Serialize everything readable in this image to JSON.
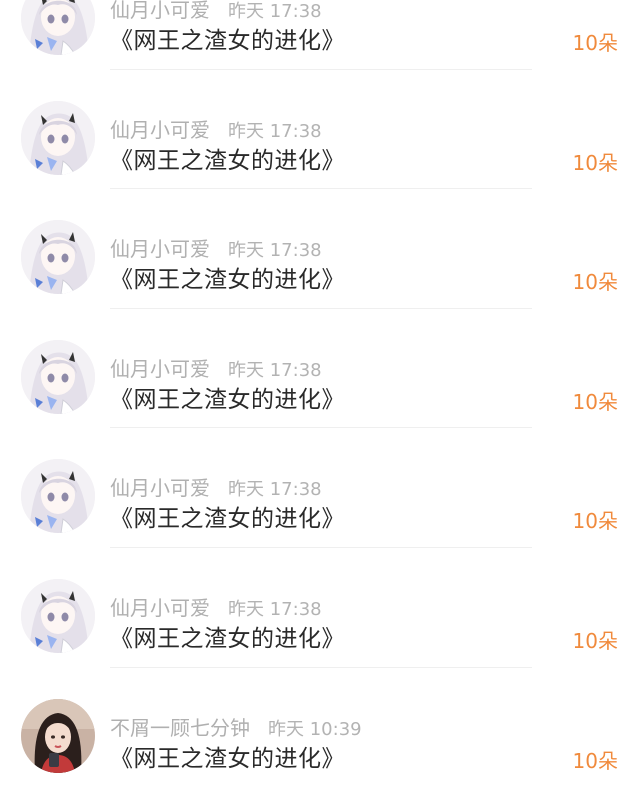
{
  "rows": [
    {
      "user": "仙月小可爱",
      "time": "昨天 17:38",
      "book": "《网王之渣女的进化》",
      "reward": "10朵",
      "avatar": "anime-girl-avatar"
    },
    {
      "user": "仙月小可爱",
      "time": "昨天 17:38",
      "book": "《网王之渣女的进化》",
      "reward": "10朵",
      "avatar": "anime-girl-avatar"
    },
    {
      "user": "仙月小可爱",
      "time": "昨天 17:38",
      "book": "《网王之渣女的进化》",
      "reward": "10朵",
      "avatar": "anime-girl-avatar"
    },
    {
      "user": "仙月小可爱",
      "time": "昨天 17:38",
      "book": "《网王之渣女的进化》",
      "reward": "10朵",
      "avatar": "anime-girl-avatar"
    },
    {
      "user": "仙月小可爱",
      "time": "昨天 17:38",
      "book": "《网王之渣女的进化》",
      "reward": "10朵",
      "avatar": "anime-girl-avatar"
    },
    {
      "user": "仙月小可爱",
      "time": "昨天 17:38",
      "book": "《网王之渣女的进化》",
      "reward": "10朵",
      "avatar": "anime-girl-avatar"
    },
    {
      "user": "不屑一顾七分钟",
      "time": "昨天 10:39",
      "book": "《网王之渣女的进化》",
      "reward": "10朵",
      "avatar": "photo-girl-avatar"
    }
  ],
  "colors": {
    "reward": "#f08a3c",
    "meta": "#b3b3b3",
    "title": "#2a2a2a",
    "divider": "#efefef"
  }
}
